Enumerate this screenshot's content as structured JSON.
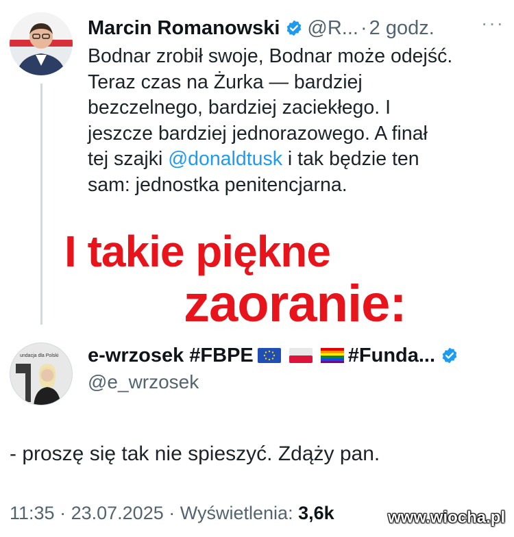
{
  "tweet1": {
    "author_name": "Marcin Romanowski",
    "handle": "@R...",
    "separator": "·",
    "time": "2 godz.",
    "more_label": "···",
    "text_lines": [
      "Bodnar zrobił swoje, Bodnar może odejść.",
      "Teraz czas na Żurka — bardziej",
      "bezczelnego, bardziej zaciekłego. I",
      "jeszcze bardziej jednorazowego. A finał",
      "tej szajki ",
      "sam: jednostka penitencjarna."
    ],
    "mention": "@donaldtusk",
    "text_after_mention": " i tak będzie ten",
    "verified_color": "#1d9bf0",
    "avatar_icon": "person-avatar"
  },
  "overlay": {
    "line1": "I takie piękne",
    "line2": "zaoranie:",
    "color": "#e8141b"
  },
  "tweet2": {
    "author_name": "e-wrzosek #FBPE",
    "name_suffix": "#Funda...",
    "handle": "@e_wrzosek",
    "flags": [
      "eu-flag",
      "poland-flag",
      "rainbow-flag"
    ],
    "avatar_caption": "undacja dla Polski",
    "reply_text": "- proszę się tak nie spieszyć. Zdąży pan."
  },
  "meta": {
    "time": "11:35",
    "separator": "·",
    "date": "23.07.2025",
    "views_label": "Wyświetlenia:",
    "views_count": "3,6k"
  },
  "watermark": "www.wiocha.pl"
}
